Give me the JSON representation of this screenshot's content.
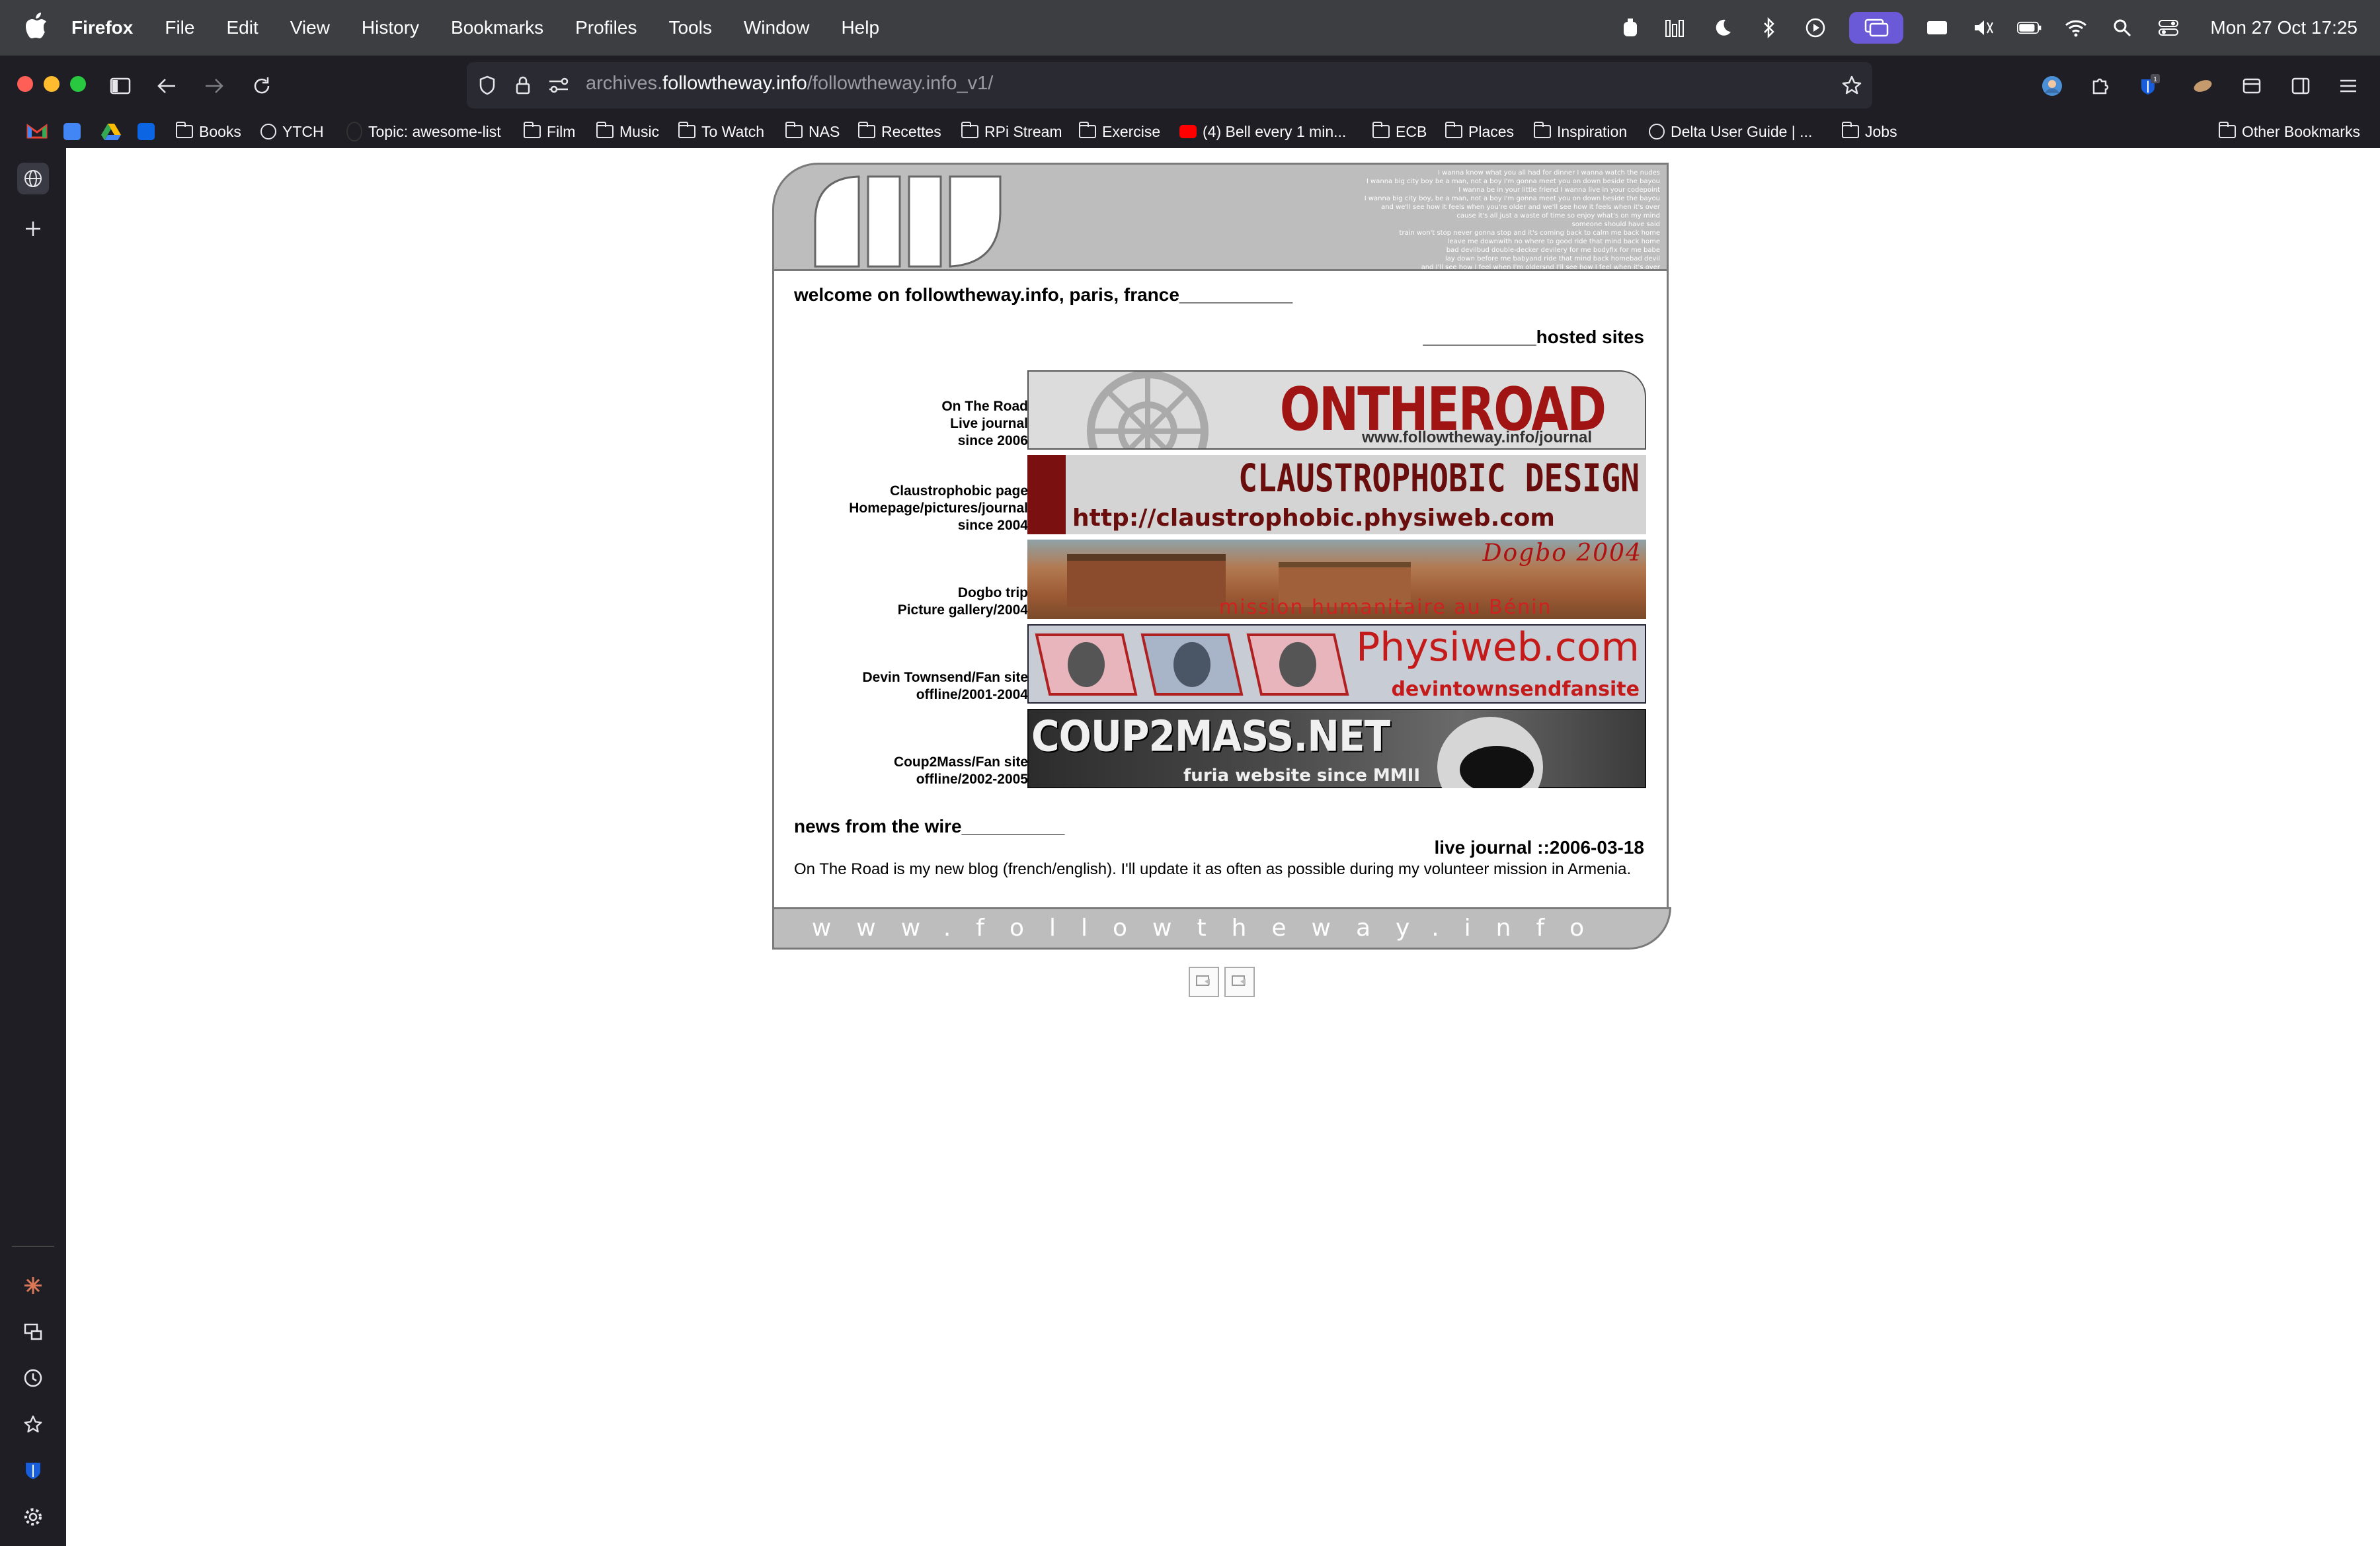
{
  "menubar": {
    "app_name": "Firefox",
    "items": [
      "File",
      "Edit",
      "View",
      "History",
      "Bookmarks",
      "Profiles",
      "Tools",
      "Window",
      "Help"
    ],
    "datetime": "Mon 27 Oct  17:25"
  },
  "toolbar": {
    "url_prefix": "archives.",
    "url_domain": "followtheway.info",
    "url_path": "/followtheway.info_v1/",
    "extension_badge": "1"
  },
  "bookmarks": [
    "Books",
    "YTCH",
    "Topic: awesome-list",
    "Film",
    "Music",
    "To Watch",
    "NAS",
    "Recettes",
    "RPi Stream",
    "Exercise",
    "(4) Bell every 1 min...",
    "ECB",
    "Places",
    "Inspiration",
    "Delta User Guide | ...",
    "Jobs",
    "Other Bookmarks"
  ],
  "site": {
    "header_lyrics": [
      "I wanna know what you all had for dinner I wanna watch the nudes",
      "I wanna big city boy be a man, not a boy I'm gonna meet you on down beside the bayou",
      "I wanna be in your little friend I wanna live in your codepoint",
      "I wanna big city boy, be a man, not a boy I'm gonna meet you on down beside the bayou",
      "and we'll see how it feels when you're older and we'll see how it feels when it's over",
      "cause it's all just a waste of time so enjoy what's on my mind",
      "someone should have said",
      "train won't stop never gonna stop and it's coming back to calm me back home",
      "leave me downwith no where to good ride that mind back home",
      "bad devilbud double-decker devilery for me bodyfix for me babe",
      "lay down before me babyand ride that mind back homebad devil",
      "and I'll see how I feel when I'm oldersnd I'll see how I feel when it's over"
    ],
    "welcome": "welcome on followtheway.info, paris, france___________",
    "hosted_title": "___________hosted sites",
    "hosted_sites": [
      {
        "label_lines": [
          "On The Road",
          "Live journal",
          "since 2006"
        ],
        "banner_title": "ONTHEROAD",
        "banner_sub": "www.followtheway.info/journal"
      },
      {
        "label_lines": [
          "Claustrophobic page",
          "Homepage/pictures/journal",
          "since 2004"
        ],
        "banner_title": "CLAUSTROPHOBIC DESIGN",
        "banner_sub": "http://claustrophobic.physiweb.com"
      },
      {
        "label_lines": [
          "Dogbo trip",
          "Picture gallery/2004"
        ],
        "banner_title": "Dogbo 2004",
        "banner_sub": "mission humanitaire au Bénin"
      },
      {
        "label_lines": [
          "Devin Townsend/Fan site",
          "offline/2001-2004"
        ],
        "banner_title": "Physiweb.com",
        "banner_sub": "devintownsendfansite"
      },
      {
        "label_lines": [
          "Coup2Mass/Fan site",
          "offline/2002-2005"
        ],
        "banner_title": "COUP2MASS.NET",
        "banner_sub": "furia website since MMII"
      }
    ],
    "news_title": "news from the wire__________",
    "news_date": "live journal ::2006-03-18",
    "news_body": "On The Road is my new blog (french/english). I'll update it as often as possible during my volunteer mission in Armenia.",
    "footer_text": "www.followtheway.info"
  },
  "colors": {
    "menubar_bg": "#3d3e42",
    "chrome_bg": "#1f1e25",
    "site_gray": "#bdbdbd",
    "site_border": "#7a7a7a",
    "banner_red": "#8b1a1a"
  }
}
